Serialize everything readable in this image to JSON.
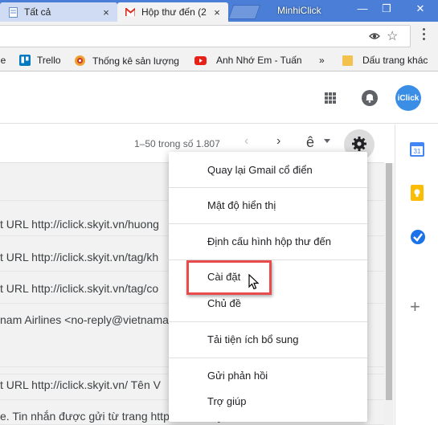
{
  "browser": {
    "tabs": [
      {
        "title": "Tất cả",
        "active": false,
        "icon": "doc-icon"
      },
      {
        "title": "Hộp thư đến (2",
        "active": true,
        "icon": "gmail-icon"
      }
    ],
    "close_glyph": "×",
    "profile_name": "MinhiClick",
    "window_controls": {
      "minimize": "—",
      "restore": "❐",
      "close": "✕"
    },
    "bookmarks": [
      {
        "label": "le",
        "icon": "none"
      },
      {
        "label": "Trello",
        "icon": "trello-icon"
      },
      {
        "label": "Thống kê sản lượng",
        "icon": "swirl-icon"
      },
      {
        "label": "Anh Nhớ Em - Tuấn",
        "icon": "youtube-icon"
      },
      {
        "label": "»",
        "icon": "none"
      },
      {
        "label": "Dấu trang khác",
        "icon": "folder-icon"
      }
    ]
  },
  "gmail": {
    "avatar_text": "iClick",
    "pager": {
      "text": "1–50 trong số 1.807",
      "prev": "‹",
      "next": "›"
    },
    "lang_label": "ê",
    "emails": [
      {
        "text": ""
      },
      {
        "text": "t URL http://iclick.skyit.vn/huong"
      },
      {
        "text": "t URL http://iclick.skyit.vn/tag/kh"
      },
      {
        "text": "t URL http://iclick.skyit.vn/tag/co"
      },
      {
        "text": "nam Airlines <no-reply@vietnamai"
      },
      {
        "text": ""
      },
      {
        "text": "t URL http://iclick.skyit.vn/ Tên V"
      },
      {
        "text": "e. Tin nhắn được gửi từ trang http://iclick.skyit.vn/ nước"
      }
    ],
    "side_plus": "+"
  },
  "settings_menu": {
    "items": [
      {
        "label": "Quay lại Gmail cổ điển"
      },
      {
        "label": "Mật độ hiển thị"
      },
      {
        "label": "Định cấu hình hộp thư đến"
      },
      {
        "label": "Cài đặt"
      },
      {
        "label": "Chủ đề"
      },
      {
        "label": "Tải tiện ích bổ sung"
      },
      {
        "label": "Gửi phản hồi"
      },
      {
        "label": "Trợ giúp"
      }
    ]
  },
  "colors": {
    "tabstrip": "#4a7ed7",
    "highlight": "#e74b4b",
    "avatar": "#3a8ee6",
    "calendar": "#4285f4",
    "keep": "#fbbc04",
    "tasks": "#1a73e8"
  }
}
